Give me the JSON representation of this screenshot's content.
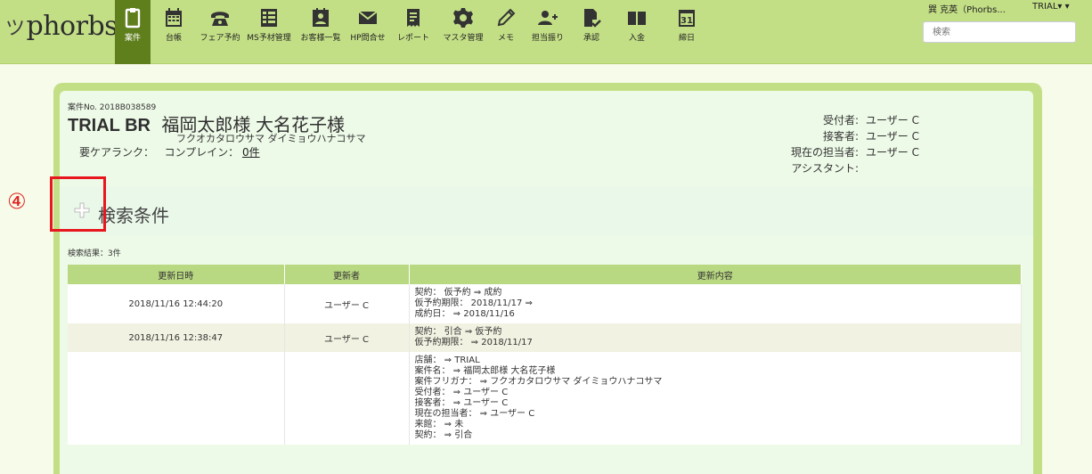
{
  "brand": {
    "name": "phorbs",
    "mark": "ツ"
  },
  "nav": [
    {
      "label": "案件",
      "icon": "clipboard-icon",
      "active": true
    },
    {
      "label": "台帳",
      "icon": "calendar-icon"
    },
    {
      "label": "フェア予約",
      "icon": "phone-icon"
    },
    {
      "label": "MS予材管理",
      "icon": "list-icon"
    },
    {
      "label": "お客様一覧",
      "icon": "contacts-icon"
    },
    {
      "label": "HP問合せ",
      "icon": "mail-icon"
    },
    {
      "label": "レポート",
      "icon": "report-icon"
    },
    {
      "label": "マスタ管理",
      "icon": "gear-icon"
    },
    {
      "label": "メモ",
      "icon": "pencil-icon"
    },
    {
      "label": "担当振り",
      "icon": "add-user-icon"
    },
    {
      "label": "承認",
      "icon": "approve-doc-icon"
    },
    {
      "label": "入金",
      "icon": "payment-icon"
    },
    {
      "label": "締日",
      "icon": "calendar-31-icon"
    }
  ],
  "user": {
    "name": "巽 克英（Phorbs...",
    "trial": "TRIAL▾"
  },
  "search": {
    "placeholder": "検索"
  },
  "case": {
    "number": "案件No. 2018B038589",
    "store": "TRIAL BR",
    "names": "福岡太郎様 大名花子様",
    "kana": "フクオカタロウサマ ダイミョウハナコサマ",
    "rank_label": "要ケアランク：",
    "complain_label": "コンプレイン：",
    "complain_count": "0件"
  },
  "staff": [
    {
      "key": "受付者:",
      "value": "ユーザー C"
    },
    {
      "key": "接客者:",
      "value": "ユーザー C"
    },
    {
      "key": "現在の担当者:",
      "value": "ユーザー C"
    },
    {
      "key": "アシスタント:",
      "value": ""
    }
  ],
  "search_conditions": {
    "title": "検索条件",
    "marker": "④"
  },
  "results": {
    "summary": "検索結果：3件"
  },
  "table": {
    "headers": [
      "更新日時",
      "更新者",
      "更新内容"
    ],
    "rows": [
      {
        "datetime": "2018/11/16 12:44:20",
        "user": "ユーザー C",
        "lines": [
          "契約： 仮予約 ⇒ 成約",
          "仮予約期限： 2018/11/17 ⇒",
          "成約日： ⇒ 2018/11/16"
        ]
      },
      {
        "datetime": "2018/11/16 12:38:47",
        "user": "ユーザー C",
        "lines": [
          "契約： 引合 ⇒ 仮予約",
          "仮予約期限： ⇒ 2018/11/17"
        ]
      },
      {
        "datetime": "",
        "user": "",
        "lines": [
          "店舗： ⇒ TRIAL",
          "案件名： ⇒ 福岡太郎様 大名花子様",
          "案件フリガナ： ⇒ フクオカタロウサマ ダイミョウハナコサマ",
          "受付者： ⇒ ユーザー C",
          "接客者： ⇒ ユーザー C",
          "現在の担当者： ⇒ ユーザー C",
          "来館： ⇒ 未",
          "契約： ⇒ 引合"
        ]
      }
    ]
  }
}
